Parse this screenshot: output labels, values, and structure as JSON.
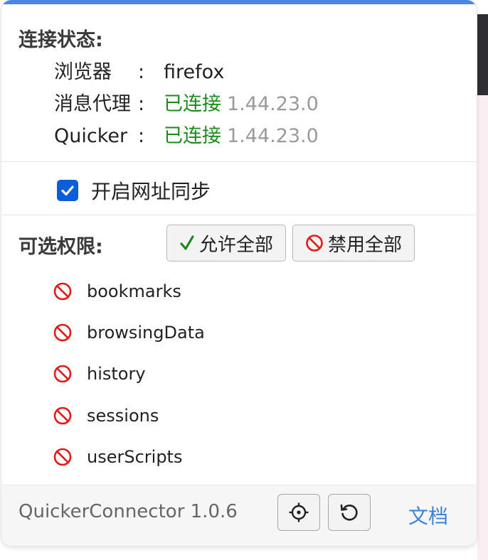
{
  "connection": {
    "title": "连接状态:",
    "browser": {
      "label": "浏览器",
      "colon": ":",
      "value": "firefox"
    },
    "proxy": {
      "label": "消息代理",
      "colon": ":",
      "status": "已连接",
      "version": "1.44.23.0"
    },
    "quicker": {
      "label": "Quicker",
      "colon": ":",
      "status": "已连接",
      "version": "1.44.23.0"
    }
  },
  "sync": {
    "label": "开启网址同步",
    "checked": true
  },
  "permissions": {
    "title": "可选权限:",
    "allow_all_label": "允许全部",
    "deny_all_label": "禁用全部",
    "items": [
      {
        "label": "bookmarks",
        "icon": "ban-icon"
      },
      {
        "label": "browsingData",
        "icon": "ban-icon"
      },
      {
        "label": "history",
        "icon": "ban-icon"
      },
      {
        "label": "sessions",
        "icon": "ban-icon"
      },
      {
        "label": "userScripts",
        "icon": "ban-icon"
      }
    ]
  },
  "footer": {
    "app_name": "QuickerConnector 1.0.6",
    "docs_label": "文档",
    "locate_icon": "crosshair-icon",
    "reload_icon": "reload-icon"
  },
  "colors": {
    "accent": "#4a86e8",
    "connected": "#1d8a1d",
    "version": "#9a9a9a",
    "ban": "#e01b1b",
    "link": "#3b82d6",
    "checkbox": "#0a5ed7"
  }
}
